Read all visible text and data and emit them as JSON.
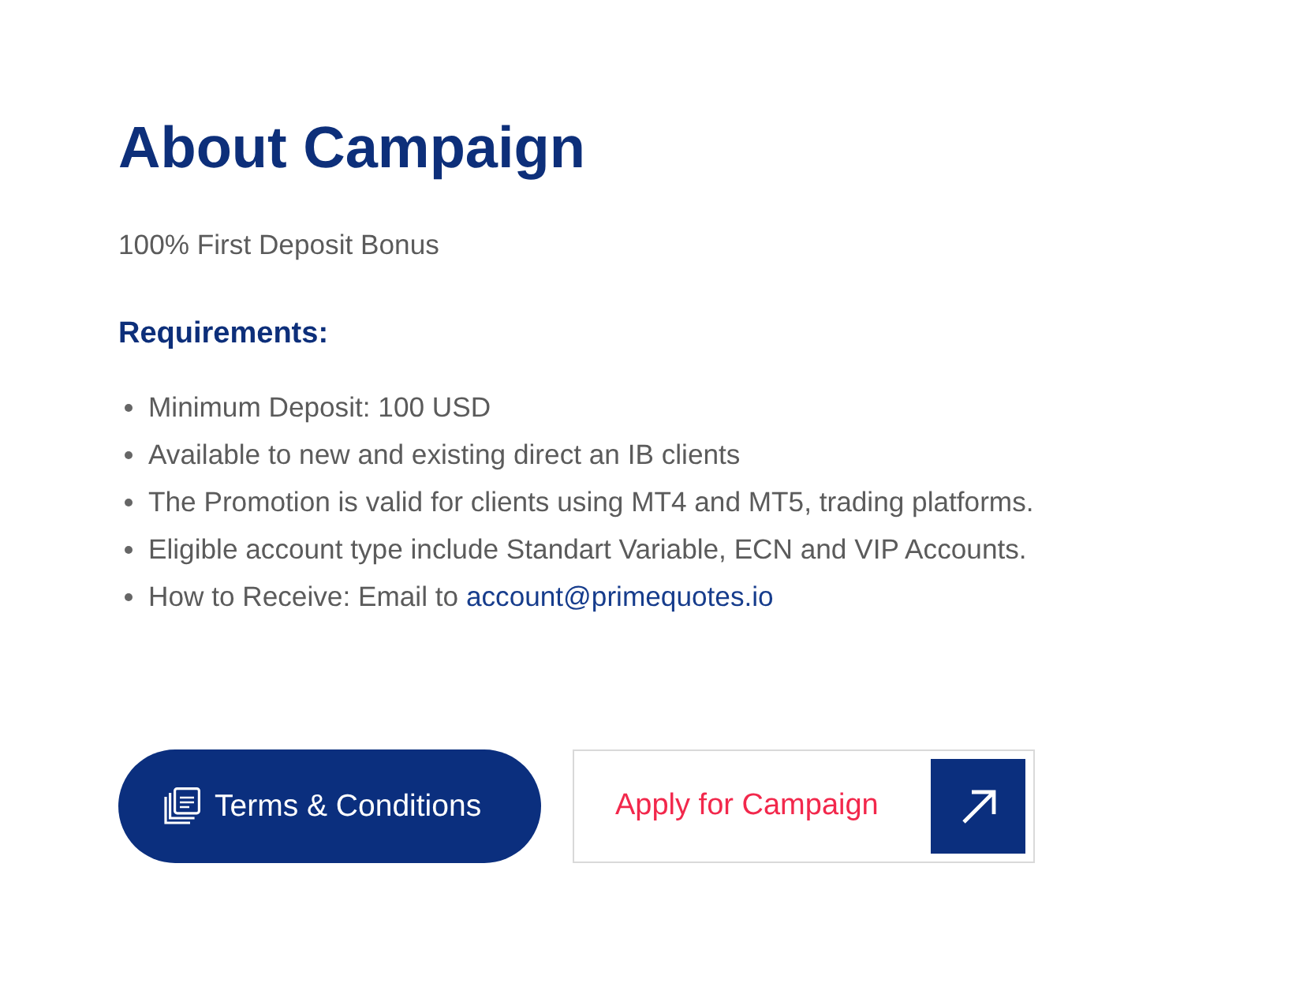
{
  "heading": "About Campaign",
  "subtitle": "100% First Deposit Bonus",
  "requirements": {
    "title": "Requirements:",
    "items": [
      {
        "text": "Minimum Deposit: 100 USD"
      },
      {
        "text": "Available to new and existing direct an IB clients"
      },
      {
        "text": "The Promotion is valid for clients using MT4 and MT5, trading platforms."
      },
      {
        "text": "Eligible account type include Standart Variable, ECN and VIP Accounts."
      },
      {
        "text": "How to Receive: Email to ",
        "link": "account@primequotes.io"
      }
    ]
  },
  "buttons": [
    {
      "kind": "pill",
      "label": "Terms & Conditions"
    },
    {
      "kind": "outline",
      "label": "Apply for Campaign"
    }
  ]
}
